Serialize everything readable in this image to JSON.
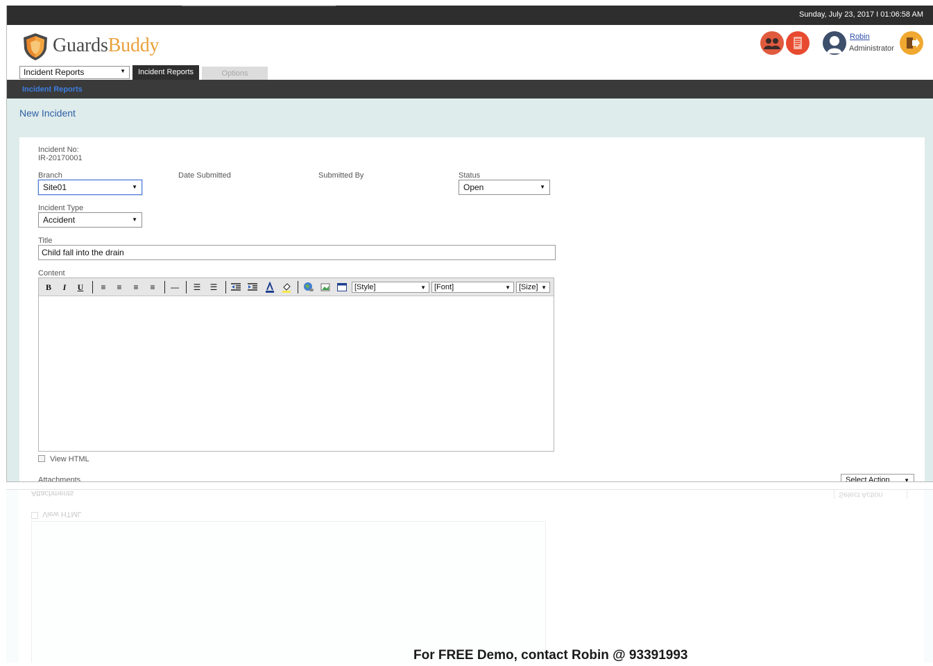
{
  "topbar": {
    "datetime": "Sunday, July 23, 2017   I   01:06:58 AM"
  },
  "brand": {
    "part1": "Guards",
    "part2": "Buddy"
  },
  "user": {
    "name": "Robin",
    "role": "Administrator"
  },
  "module_select": {
    "value": "Incident Reports"
  },
  "tabs": [
    {
      "label": "Incident Reports",
      "active": true
    },
    {
      "label": "Options",
      "active": false
    }
  ],
  "breadcrumb": "Incident Reports",
  "page_title": "New Incident",
  "form": {
    "incident_no_label": "Incident No:",
    "incident_no_value": "IR-20170001",
    "branch_label": "Branch",
    "branch_value": "Site01",
    "date_submitted_label": "Date Submitted",
    "submitted_by_label": "Submitted By",
    "status_label": "Status",
    "status_value": "Open",
    "incident_type_label": "Incident Type",
    "incident_type_value": "Accident",
    "title_label": "Title",
    "title_value": "Child fall into the drain",
    "content_label": "Content",
    "style_dropdown": "[Style]",
    "font_dropdown": "[Font]",
    "size_dropdown": "[Size]",
    "view_html_label": "View HTML",
    "attachments_label": "Attachments",
    "select_action": "Select Action"
  },
  "toolbar_icons": {
    "bold": "B",
    "italic": "I",
    "underline": "U",
    "align_left": "≡",
    "align_center": "≡",
    "align_right": "≡",
    "justify": "≡",
    "hr": "—",
    "ol": "☰",
    "ul": "☰"
  },
  "colors": {
    "topbar": "#2e2e2e",
    "accent_blue": "#2d5fa3",
    "band": "#dfecec",
    "icon_red": "#e05a3e",
    "icon_orange": "#f0a830"
  },
  "footer_promo": "For FREE Demo, contact Robin @ 93391993"
}
